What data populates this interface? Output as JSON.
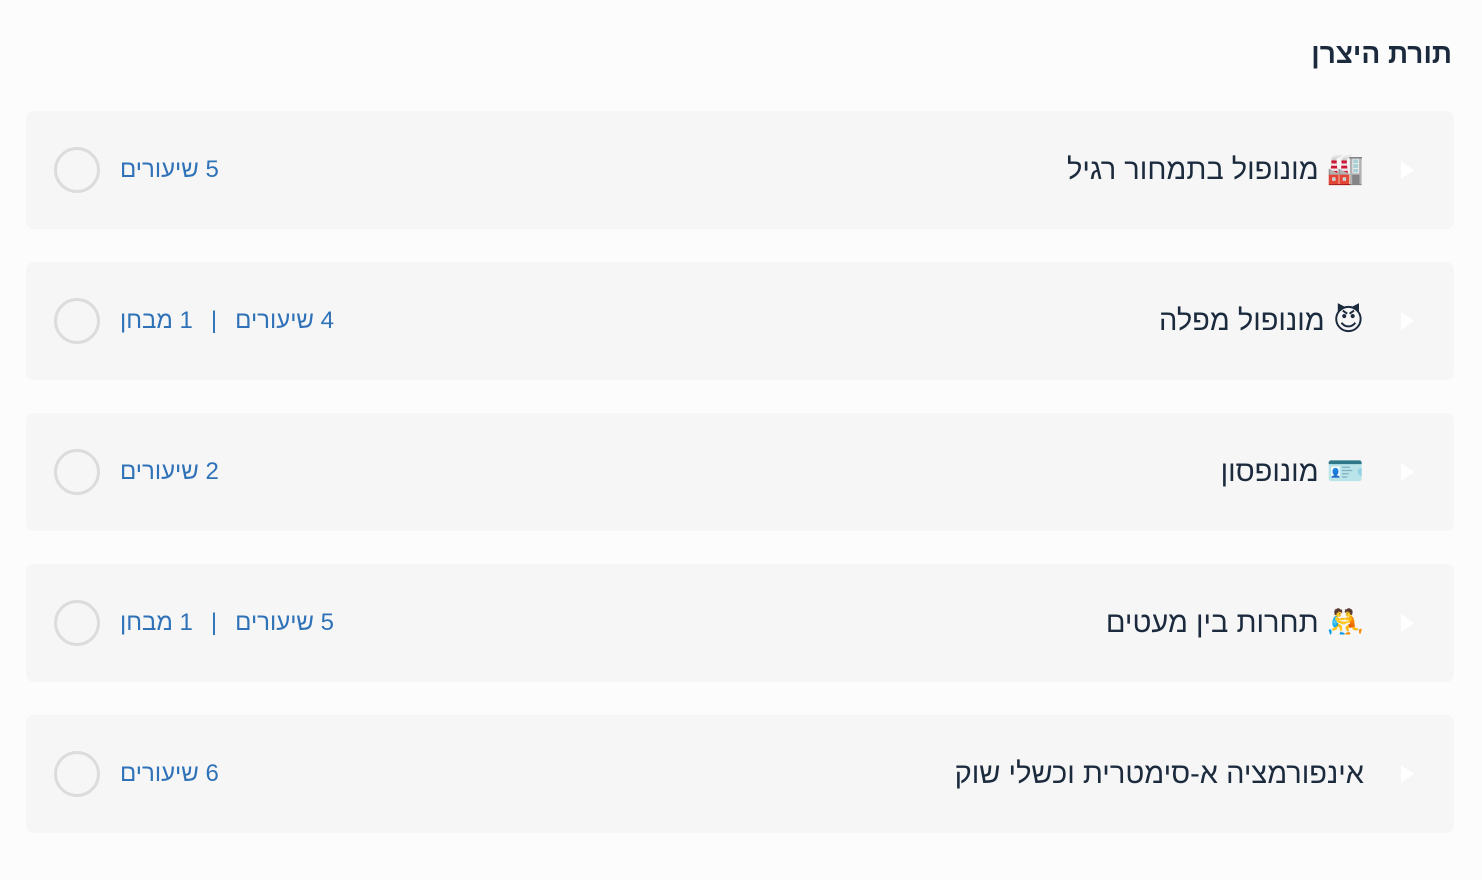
{
  "section": {
    "title": "תורת היצרן"
  },
  "courses": [
    {
      "emoji": "🏭",
      "title": "מונופול בתמחור רגיל",
      "lessons": "5 שיעורים",
      "separator": "",
      "quizzes": ""
    },
    {
      "emoji": "😈",
      "title": "מונופול מפלה",
      "lessons": "4 שיעורים",
      "separator": "|",
      "quizzes": "1 מבחן"
    },
    {
      "emoji": "🪪",
      "title": "מונופסון",
      "lessons": "2 שיעורים",
      "separator": "",
      "quizzes": ""
    },
    {
      "emoji": "🤼",
      "title": "תחרות בין מעטים",
      "lessons": "5 שיעורים",
      "separator": "|",
      "quizzes": "1 מבחן"
    },
    {
      "emoji": "",
      "title": "אינפורמציה א-סימטרית וכשלי שוק",
      "lessons": "6 שיעורים",
      "separator": "",
      "quizzes": ""
    }
  ],
  "colors": {
    "title": "#1b2a3d",
    "meta": "#2f72b8",
    "card": "#f6f6f6",
    "circle_border": "#dcdcdc"
  },
  "icons": {
    "expand": "caret-left-icon",
    "status": "empty-circle-icon"
  }
}
